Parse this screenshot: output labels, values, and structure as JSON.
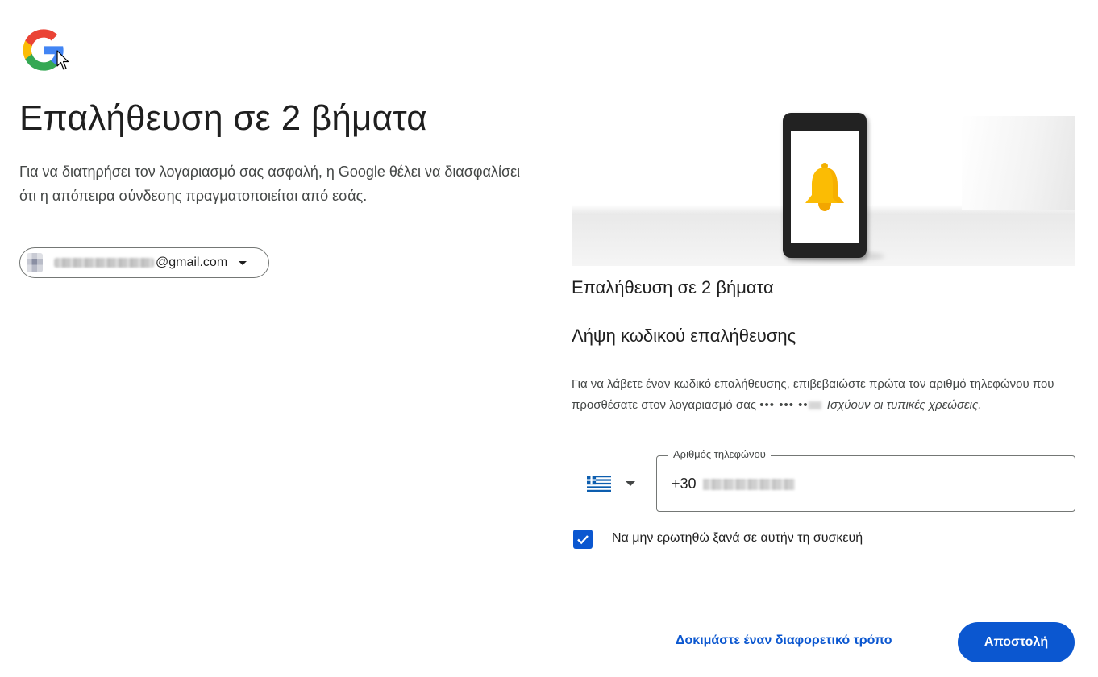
{
  "header": {
    "logo_icon": "google-g-logo-icon",
    "cursor_icon": "mouse-pointer-icon"
  },
  "left": {
    "title": "Επαλήθευση σε 2 βήματα",
    "subtitle": "Για να διατηρήσει τον λογαριασμό σας ασφαλή, η Google θέλει να διασφαλίσει ότι η απόπειρα σύνδεσης πραγματοποιείται από εσάς.",
    "account_email_suffix": "@gmail.com"
  },
  "card": {
    "heading": "Επαλήθευση σε 2 βήματα",
    "subheading": "Λήψη κωδικού επαλήθευσης",
    "text_main": "Για να λάβετε έναν κωδικό επαλήθευσης, επιβεβαιώστε πρώτα τον αριθμό τηλεφώνου που προσθέσατε στον λογαριασμό σας ",
    "masked_number": "••• ••• ••",
    "text_italic": "Ισχύουν οι τυπικές χρεώσεις.",
    "phone_label": "Αριθμός τηλεφώνου",
    "phone_prefix": "+30",
    "checkbox_label": "Να μην ερωτηθώ ξανά σε αυτήν τη συσκευή",
    "checkbox_checked": true
  },
  "actions": {
    "try_another": "Δοκιμάστε έναν διαφορετικό τρόπο",
    "send": "Αποστολή"
  },
  "colors": {
    "primary": "#0b57d0",
    "bell": "#fbbc04"
  }
}
